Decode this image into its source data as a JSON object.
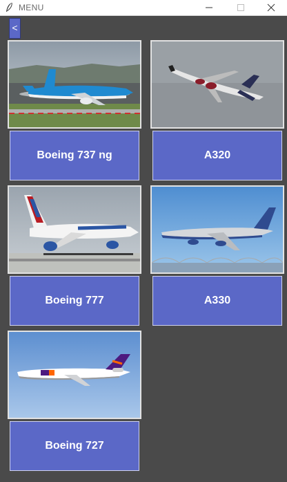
{
  "window": {
    "title": "MENU"
  },
  "back_button": {
    "label": "<"
  },
  "aircraft": [
    {
      "label": "Boeing 737 ng",
      "photo": "klm-boeing-737-photo"
    },
    {
      "label": "A320",
      "photo": "sas-a320-photo"
    },
    {
      "label": "Boeing 777",
      "photo": "transaero-boeing-777-photo"
    },
    {
      "label": "A330",
      "photo": "aeroflot-a330-photo"
    },
    {
      "label": "Boeing 727",
      "photo": "fedex-boeing-727-photo"
    }
  ]
}
